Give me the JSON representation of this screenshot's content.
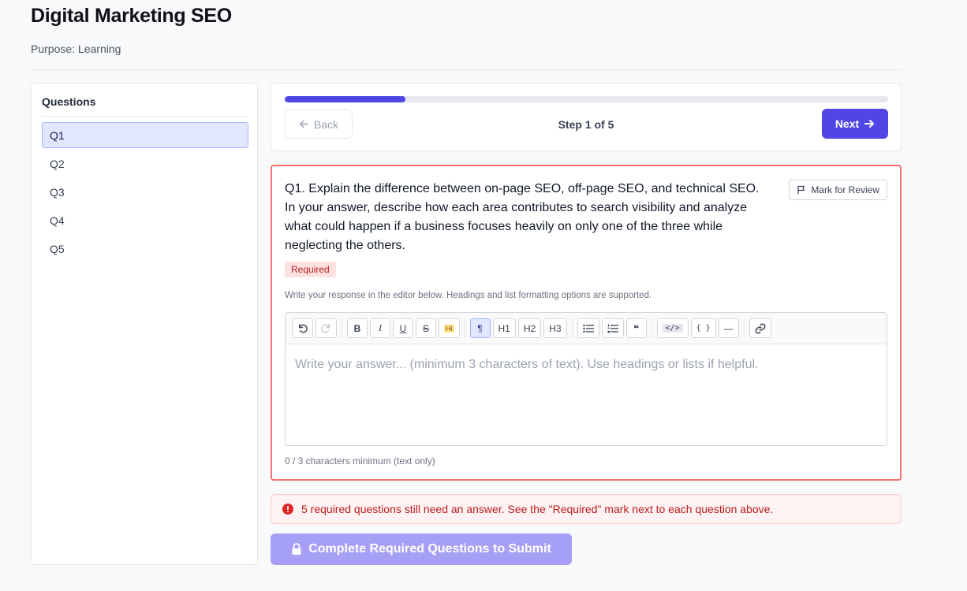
{
  "header": {
    "title": "Digital Marketing SEO",
    "purpose": "Purpose: Learning"
  },
  "sidebar": {
    "title": "Questions",
    "items": [
      {
        "label": "Q1",
        "active": true
      },
      {
        "label": "Q2",
        "active": false
      },
      {
        "label": "Q3",
        "active": false
      },
      {
        "label": "Q4",
        "active": false
      },
      {
        "label": "Q5",
        "active": false
      }
    ]
  },
  "stepper": {
    "progress_percent": 20,
    "back_label": "Back",
    "step_label": "Step 1 of 5",
    "next_label": "Next"
  },
  "question": {
    "text": "Q1. Explain the difference between on-page SEO, off-page SEO, and technical SEO. In your answer, describe how each area contributes to search visibility and analyze what could happen if a business focuses heavily on only one of the three while neglecting the others.",
    "mark_review_label": "Mark for Review",
    "required_label": "Required",
    "hint": "Write your response in the editor below. Headings and list formatting options are supported.",
    "editor_placeholder": "Write your answer... (minimum 3 characters of text). Use headings or lists if helpful.",
    "char_count": "0 / 3 characters minimum (text only)"
  },
  "toolbar": {
    "bold": "B",
    "italic": "I",
    "underline": "U",
    "strike": "S",
    "highlight": "Hi",
    "paragraph": "¶",
    "h1": "H1",
    "h2": "H2",
    "h3": "H3",
    "quote": "❝",
    "code": "</>",
    "code_block": "{ }",
    "hr": "—"
  },
  "alert": {
    "message": "5 required questions still need an answer. See the \"Required\" mark next to each question above."
  },
  "submit": {
    "label": "Complete Required Questions to Submit"
  },
  "colors": {
    "accent": "#4f46e5",
    "error": "#b91c1c",
    "submit_disabled": "#a5a0f5"
  }
}
